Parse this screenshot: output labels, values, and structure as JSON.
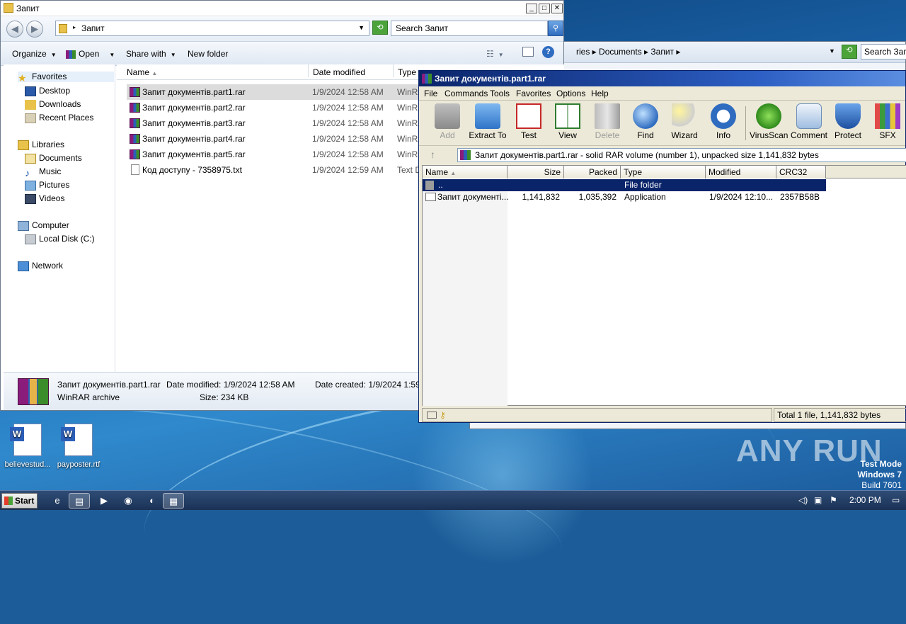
{
  "explorer": {
    "title": "Запит",
    "address": "Запит",
    "search_placeholder": "Search Запит",
    "commands": {
      "organize": "Organize",
      "open": "Open",
      "share": "Share with",
      "new_folder": "New folder"
    },
    "nav": {
      "favorites": "Favorites",
      "desktop": "Desktop",
      "downloads": "Downloads",
      "recent": "Recent Places",
      "libraries": "Libraries",
      "documents": "Documents",
      "music": "Music",
      "pictures": "Pictures",
      "videos": "Videos",
      "computer": "Computer",
      "local_disk": "Local Disk (C:)",
      "network": "Network"
    },
    "columns": {
      "name": "Name",
      "date": "Date modified",
      "type": "Type"
    },
    "files": [
      {
        "name": "Запит документів.part1.rar",
        "date": "1/9/2024 12:58 AM",
        "type": "WinRA"
      },
      {
        "name": "Запит документів.part2.rar",
        "date": "1/9/2024 12:58 AM",
        "type": "WinRA"
      },
      {
        "name": "Запит документів.part3.rar",
        "date": "1/9/2024 12:58 AM",
        "type": "WinRA"
      },
      {
        "name": "Запит документів.part4.rar",
        "date": "1/9/2024 12:58 AM",
        "type": "WinRA"
      },
      {
        "name": "Запит документів.part5.rar",
        "date": "1/9/2024 12:58 AM",
        "type": "WinRA"
      },
      {
        "name": "Код доступу - 7358975.txt",
        "date": "1/9/2024 12:59 AM",
        "type": "Text D"
      }
    ],
    "status": {
      "name": "Запит документів.part1.rar",
      "modified": "Date modified: 1/9/2024 12:58 AM",
      "created": "Date created: 1/9/2024 1:59 F",
      "kind": "WinRAR archive",
      "size": "Size: 234 KB"
    }
  },
  "explorer2": {
    "breadcrumb": "ries ▸ Documents ▸ Запит ▸",
    "search": "Search Запи"
  },
  "winrar": {
    "title": "Запит документів.part1.rar",
    "menu": [
      "File",
      "Commands",
      "Tools",
      "Favorites",
      "Options",
      "Help"
    ],
    "tools": [
      {
        "label": "Add",
        "icon": "add-icon",
        "disabled": true
      },
      {
        "label": "Extract To",
        "icon": "extract-icon",
        "disabled": false
      },
      {
        "label": "Test",
        "icon": "test-icon",
        "disabled": false
      },
      {
        "label": "View",
        "icon": "view-icon",
        "disabled": false
      },
      {
        "label": "Delete",
        "icon": "delete-icon",
        "disabled": true
      },
      {
        "label": "Find",
        "icon": "find-icon",
        "disabled": false
      },
      {
        "label": "Wizard",
        "icon": "wizard-icon",
        "disabled": false
      },
      {
        "label": "Info",
        "icon": "info-icon",
        "disabled": false
      },
      {
        "label": "VirusScan",
        "icon": "virusscan-icon",
        "disabled": false
      },
      {
        "label": "Comment",
        "icon": "comment-icon",
        "disabled": false
      },
      {
        "label": "Protect",
        "icon": "protect-icon",
        "disabled": false
      },
      {
        "label": "SFX",
        "icon": "sfx-icon",
        "disabled": false
      }
    ],
    "path": "Запит документів.part1.rar - solid RAR volume (number 1), unpacked size 1,141,832 bytes",
    "columns": {
      "name": "Name",
      "size": "Size",
      "packed": "Packed",
      "type": "Type",
      "modified": "Modified",
      "crc": "CRC32"
    },
    "rows": [
      {
        "name": "..",
        "size": "",
        "packed": "",
        "type": "File folder",
        "modified": "",
        "crc": ""
      },
      {
        "name": "Запит документі...",
        "size": "1,141,832",
        "packed": "1,035,392",
        "type": "Application",
        "modified": "1/9/2024 12:10...",
        "crc": "2357B58B"
      }
    ],
    "status": "Total 1 file, 1,141,832 bytes"
  },
  "desktop": {
    "icons": [
      {
        "label": "believestud..."
      },
      {
        "label": "payposter.rtf"
      }
    ],
    "watermark": "ANY RUN",
    "test_mode": "Test Mode",
    "os": "Windows 7",
    "build": "Build 7601"
  },
  "taskbar": {
    "start": "Start",
    "clock": "2:00 PM"
  }
}
